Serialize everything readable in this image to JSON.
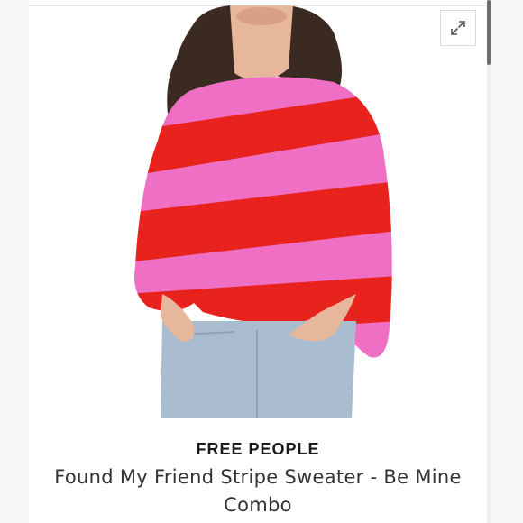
{
  "product": {
    "brand": "FREE PEOPLE",
    "title": "Found My Friend Stripe Sweater - Be Mine Combo"
  },
  "icons": {
    "expand": "expand-arrows-icon"
  },
  "colors": {
    "stripe_red": "#e8231e",
    "stripe_pink": "#ee6fc4",
    "denim": "#a9bcd0",
    "skin": "#e7b79c",
    "hair": "#3a2a22"
  }
}
